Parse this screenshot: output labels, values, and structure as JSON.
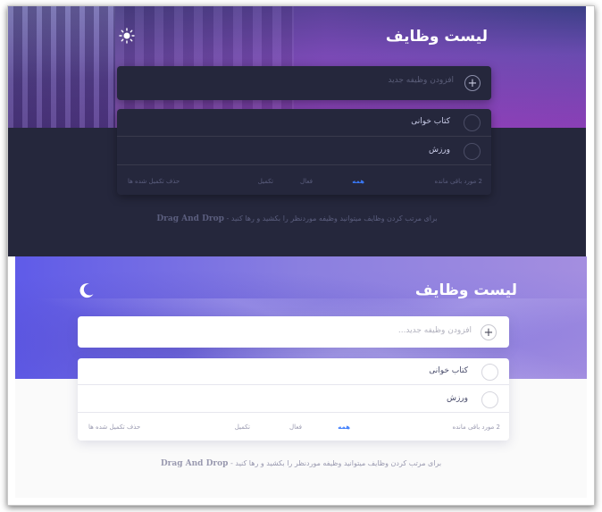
{
  "dark": {
    "title": "لیست وظایف",
    "theme_icon": "sun-icon",
    "input_placeholder": "افزودن وظیفه جدید",
    "todos": [
      {
        "text": "کتاب خوانی"
      },
      {
        "text": "ورزش"
      }
    ],
    "footer": {
      "count": "2 مورد باقی مانده",
      "filter_all": "همه",
      "filter_active": "فعال",
      "filter_completed": "تکمیل",
      "clear_completed": "حذف تکمیل شده ها"
    },
    "hint_text": "برای مرتب کردن وظایف میتوانید وظیفه موردنظر را بکشید و رها کنید - ",
    "hint_brand": "Drag And Drop"
  },
  "light": {
    "title": "لیست وظایف",
    "theme_icon": "moon-icon",
    "input_placeholder": "افزودن وظیفه جدید...",
    "todos": [
      {
        "text": "کتاب خوانی"
      },
      {
        "text": "ورزش"
      }
    ],
    "footer": {
      "count": "2 مورد باقی مانده",
      "filter_all": "همه",
      "filter_active": "فعال",
      "filter_completed": "تکمیل",
      "clear_completed": "حذف تکمیل شده ها"
    },
    "hint_text": "برای مرتب کردن وظایف میتوانید وظیفه موردنظر را بکشید و رها کنید - ",
    "hint_brand": "Drag And Drop"
  },
  "colors": {
    "accent": "#3a7bfd",
    "dark_bg": "#25273c",
    "light_bg": "#fafafa"
  }
}
